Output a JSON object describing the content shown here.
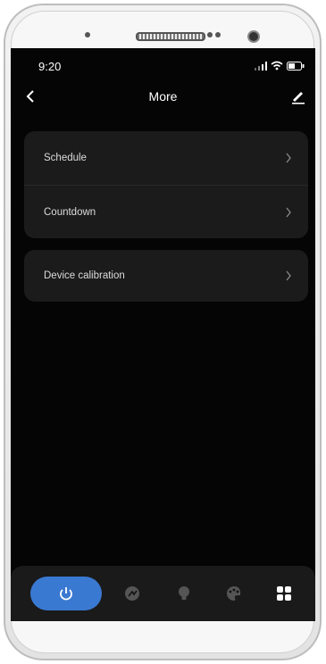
{
  "status_bar": {
    "time": "9:20"
  },
  "header": {
    "title": "More"
  },
  "menu": {
    "group1": [
      {
        "label": "Schedule"
      },
      {
        "label": "Countdown"
      }
    ],
    "group2": [
      {
        "label": "Device calibration"
      }
    ]
  },
  "bottom_nav": {
    "items": [
      "power-icon",
      "scene-icon",
      "bulb-icon",
      "palette-icon",
      "more-grid-icon"
    ],
    "active": "power-icon"
  },
  "colors": {
    "accent": "#3a79d1",
    "screen_bg": "#050505",
    "card_bg": "#1b1b1b"
  }
}
